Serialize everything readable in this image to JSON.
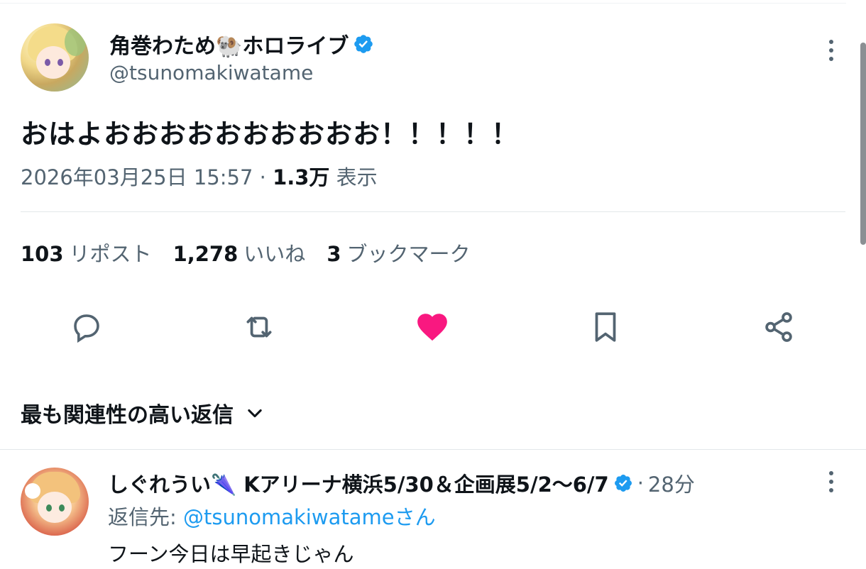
{
  "tweet": {
    "author_name": "角巻わため🐏ホロライブ",
    "author_handle": "@tsunomakiwatame",
    "text": "おはよおおおおおおおおおお！！！！！",
    "timestamp": "2026年03月25日 15:57",
    "separator": "·",
    "views_count": "1.3万",
    "views_label": "表示"
  },
  "stats": {
    "reposts_count": "103",
    "reposts_label": "リポスト",
    "likes_count": "1,278",
    "likes_label": "いいね",
    "bookmarks_count": "3",
    "bookmarks_label": "ブックマーク"
  },
  "actions": {
    "icons": [
      "reply-icon",
      "retweet-icon",
      "heart-icon",
      "bookmark-icon",
      "share-icon"
    ],
    "liked": true,
    "like_color": "#f91880",
    "icon_color": "#536471"
  },
  "sort": {
    "label": "最も関連性の高い返信"
  },
  "reply": {
    "author_name": "しぐれうい🌂 Kアリーナ横浜5/30＆企画展5/2〜6/7",
    "separator": "·",
    "time": "28分",
    "reply_to_prefix": "返信先:",
    "reply_to_mention": "@tsunomakiwatameさん",
    "text": "フーン今日は早起きじゃん"
  },
  "colors": {
    "accent": "#1d9bf0",
    "secondary_text": "#536471",
    "verified": "#1d9bf0"
  }
}
